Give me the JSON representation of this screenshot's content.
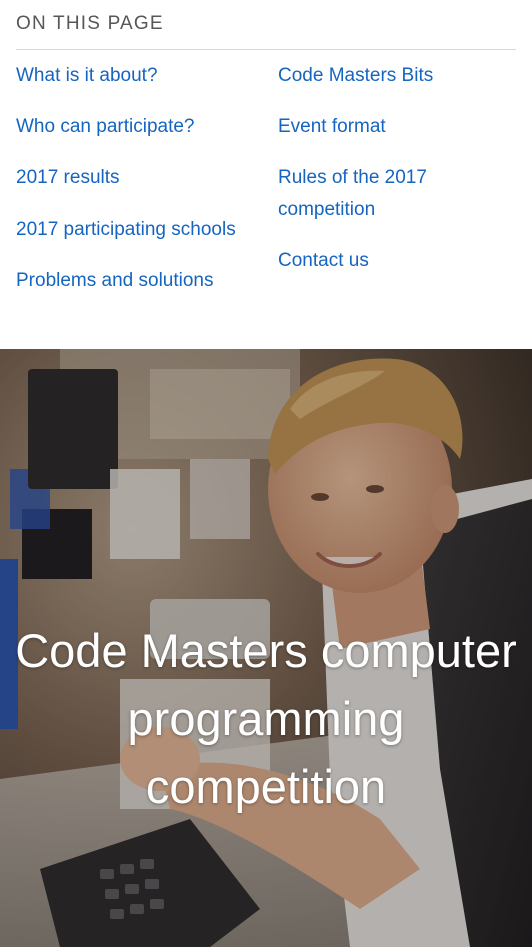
{
  "toc": {
    "heading": "ON THIS PAGE",
    "col1": [
      "What is it about?",
      "Who can participate?",
      "2017 results",
      "2017 participating schools",
      "Problems and solutions"
    ],
    "col2": [
      "Code Masters Bits",
      "Event format",
      "Rules of the 2017 competition",
      "Contact us"
    ]
  },
  "hero": {
    "title_line1": "Code Masters computer",
    "title_line2": "programming",
    "title_line3": "competition",
    "image_subject": "student-at-computer-photo"
  },
  "colors": {
    "link": "#1565c0",
    "heading": "#575757",
    "rule": "#d8d8d8",
    "hero_text": "#ffffff"
  }
}
